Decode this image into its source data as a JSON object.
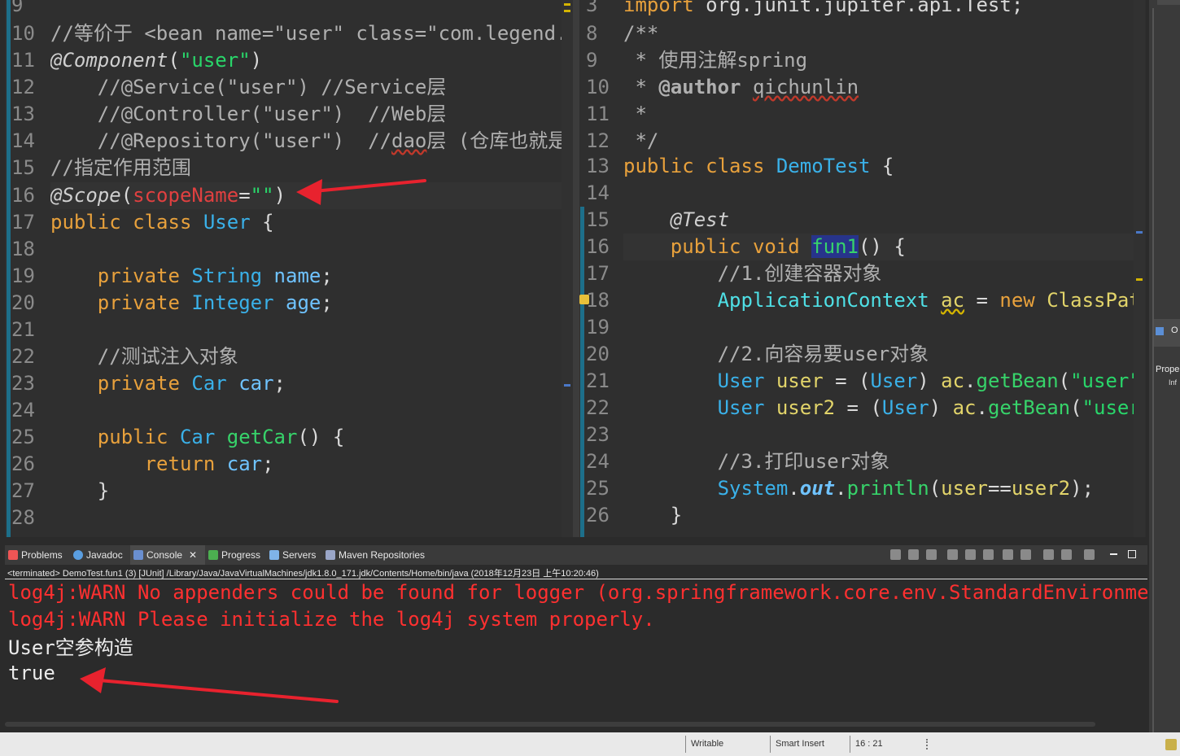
{
  "left_editor": {
    "lines": [
      {
        "n": "9"
      },
      {
        "n": "10"
      },
      {
        "n": "11"
      },
      {
        "n": "12"
      },
      {
        "n": "13"
      },
      {
        "n": "14"
      },
      {
        "n": "15"
      },
      {
        "n": "16"
      },
      {
        "n": "17"
      },
      {
        "n": "18"
      },
      {
        "n": "19"
      },
      {
        "n": "20"
      },
      {
        "n": "21"
      },
      {
        "n": "22"
      },
      {
        "n": "23"
      },
      {
        "n": "24"
      },
      {
        "n": "25"
      },
      {
        "n": "26"
      },
      {
        "n": "27"
      },
      {
        "n": "28"
      }
    ],
    "t": {
      "l10": "//等价于 <bean name=\"user\" class=\"com.legend.",
      "l11a": "@Component",
      "l11b": "(",
      "l11c": "\"user\"",
      "l11d": ")",
      "l12": "    //@Service(\"user\") //Service层",
      "l13": "    //@Controller(\"user\")  //Web层",
      "l14a": "    //@Repository(\"user\")  //",
      "l14b": "dao",
      "l14c": "层 (仓库也就是",
      "l15": "//指定作用范围",
      "l16a": "@Scope",
      "l16b": "(",
      "l16c": "scopeName",
      "l16d": "=",
      "l16e": "\"\"",
      "l16f": ")",
      "l17a": "public class ",
      "l17b": "User",
      "l17c": " {",
      "l19a": "    private ",
      "l19b": "String",
      "l19c": " name",
      "l19d": ";",
      "l20a": "    private ",
      "l20b": "Integer",
      "l20c": " age",
      "l20d": ";",
      "l22": "    //测试注入对象",
      "l23a": "    private ",
      "l23b": "Car",
      "l23c": " car",
      "l23d": ";",
      "l25a": "    public ",
      "l25b": "Car",
      "l25c": " getCar",
      "l25d": "() {",
      "l26a": "        return ",
      "l26b": "car",
      "l26c": ";",
      "l27": "    }"
    }
  },
  "right_editor": {
    "lines": [
      {
        "n": "3"
      },
      {
        "n": "8"
      },
      {
        "n": "9"
      },
      {
        "n": "10"
      },
      {
        "n": "11"
      },
      {
        "n": "12"
      },
      {
        "n": "13"
      },
      {
        "n": "14"
      },
      {
        "n": "15"
      },
      {
        "n": "16"
      },
      {
        "n": "17"
      },
      {
        "n": "18"
      },
      {
        "n": "19"
      },
      {
        "n": "20"
      },
      {
        "n": "21"
      },
      {
        "n": "22"
      },
      {
        "n": "23"
      },
      {
        "n": "24"
      },
      {
        "n": "25"
      },
      {
        "n": "26"
      }
    ],
    "t": {
      "l3a": "import",
      "l3b": " org.junit.jupiter.api.Test;",
      "l8": "/**",
      "l9": " * 使用注解spring",
      "l10a": " * ",
      "l10b": "@author",
      "l10c": " ",
      "l10d": "qichunlin",
      "l11": " *",
      "l12": " */",
      "l13a": "public class ",
      "l13b": "DemoTest",
      "l13c": " {",
      "l15": "    @Test",
      "l16a": "    public void ",
      "l16b": "fun1",
      "l16c": "() {",
      "l17": "        //1.创建容器对象",
      "l18a": "        ",
      "l18b": "ApplicationContext",
      "l18c": " ",
      "l18d": "ac",
      "l18e": " = ",
      "l18f": "new",
      "l18g": " ClassPat",
      "l20": "        //2.向容易要user对象",
      "l21a": "        ",
      "l21b": "User",
      "l21c": " user",
      "l21d": " = (",
      "l21e": "User",
      "l21f": ") ",
      "l21g": "ac",
      "l21h": ".",
      "l21i": "getBean",
      "l21j": "(",
      "l21k": "\"user\"",
      "l22a": "        ",
      "l22b": "User",
      "l22c": " user2",
      "l22d": " = (",
      "l22e": "User",
      "l22f": ") ",
      "l22g": "ac",
      "l22h": ".",
      "l22i": "getBean",
      "l22j": "(",
      "l22k": "\"user",
      "l24": "        //3.打印user对象",
      "l25a": "        ",
      "l25b": "System",
      "l25c": ".",
      "l25d": "out",
      "l25e": ".",
      "l25f": "println",
      "l25g": "(",
      "l25h": "user",
      "l25i": "==",
      "l25j": "user2",
      "l25k": ");",
      "l26": "    }"
    }
  },
  "side_panel": {
    "outline_label": "O",
    "prop_label": "Prope",
    "info_label": "Inf"
  },
  "tabs": {
    "problems": "Problems",
    "javadoc": "Javadoc",
    "console": "Console",
    "close": "✕",
    "progress": "Progress",
    "servers": "Servers",
    "maven": "Maven Repositories"
  },
  "console": {
    "terminated": "<terminated> DemoTest.fun1 (3) [JUnit] /Library/Java/JavaVirtualMachines/jdk1.8.0_171.jdk/Contents/Home/bin/java (2018年12月23日 上午10:20:46)",
    "l1": "log4j:WARN No appenders could be found for logger (org.springframework.core.env.StandardEnvironme",
    "l2": "log4j:WARN Please initialize the log4j system properly.",
    "l3": "User空参构造",
    "l4": "true"
  },
  "status": {
    "writable": "Writable",
    "insert": "Smart Insert",
    "pos": "16 : 21"
  },
  "colors": {
    "accent_arrow": "#e8222e",
    "error_text": "#ff3030",
    "bar": "#1d6f8a"
  }
}
